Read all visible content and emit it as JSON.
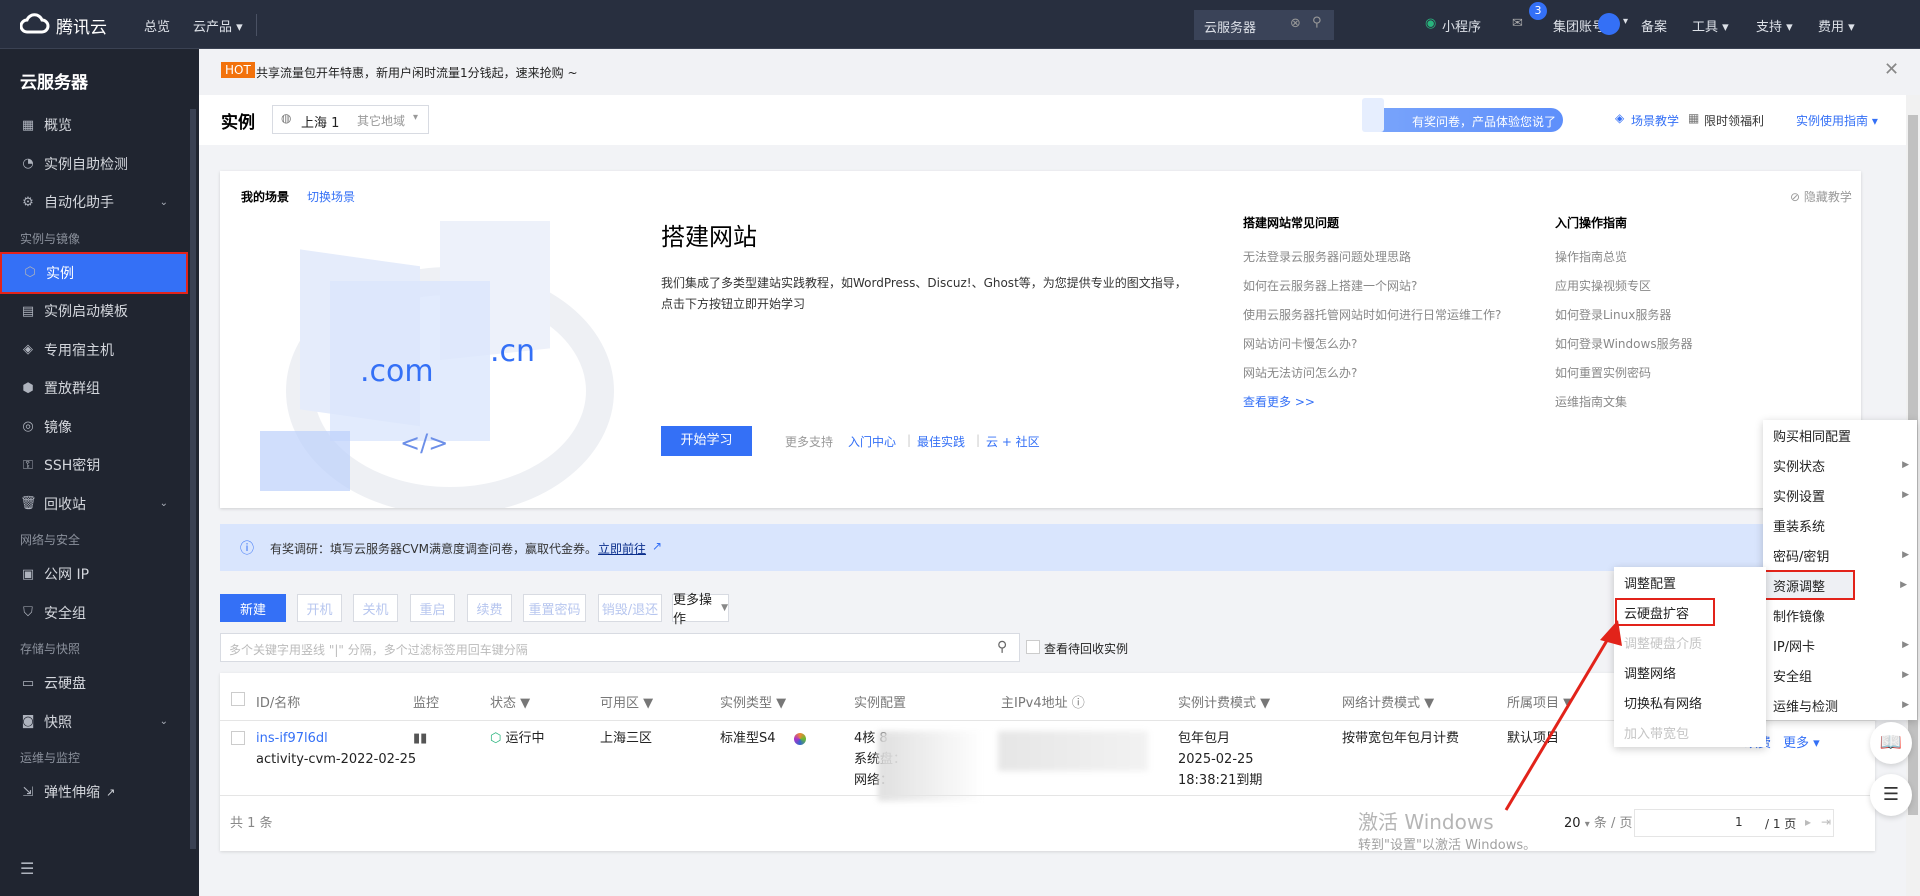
{
  "topbar": {
    "logo": "腾讯云",
    "nav": [
      "总览",
      "云产品"
    ],
    "search_value": "云服务器",
    "mini_program": "小程序",
    "mail_badge": "3",
    "items": [
      "集团账号",
      "备案",
      "工具",
      "支持",
      "费用"
    ]
  },
  "sidebar": {
    "title": "云服务器",
    "items": [
      {
        "label": "概览",
        "icon": "grid-icon"
      },
      {
        "label": "实例自助检测",
        "icon": "gauge-icon"
      },
      {
        "label": "自动化助手",
        "icon": "gear-icon",
        "arrow": true
      },
      {
        "section": "实例与镜像"
      },
      {
        "label": "实例",
        "icon": "cube-icon",
        "active": true
      },
      {
        "label": "实例启动模板",
        "icon": "template-icon"
      },
      {
        "label": "专用宿主机",
        "icon": "layers-icon"
      },
      {
        "label": "置放群组",
        "icon": "shield-icon"
      },
      {
        "label": "镜像",
        "icon": "disc-icon"
      },
      {
        "label": "SSH密钥",
        "icon": "key-icon"
      },
      {
        "label": "回收站",
        "icon": "trash-icon",
        "arrow": true
      },
      {
        "section": "网络与安全"
      },
      {
        "label": "公网 IP",
        "icon": "ip-icon"
      },
      {
        "label": "安全组",
        "icon": "security-icon"
      },
      {
        "section": "存储与快照"
      },
      {
        "label": "云硬盘",
        "icon": "disk-icon"
      },
      {
        "label": "快照",
        "icon": "camera-icon",
        "arrow": true
      },
      {
        "section": "运维与监控"
      },
      {
        "label": "弹性伸缩",
        "icon": "scale-icon",
        "external": true
      }
    ]
  },
  "hot": {
    "badge": "HOT",
    "text": "共享流量包开年特惠，新用户闲时流量1分钱起，速来抢购 ~"
  },
  "header": {
    "title": "实例",
    "region": "上海 1",
    "other_region": "其它地域",
    "survey": "有奖问卷，产品体验您说了算",
    "scene_teach": "场景教学",
    "benefit": "限时领福利",
    "guide": "实例使用指南"
  },
  "scene": {
    "label": "我的场景",
    "switch": "切换场景",
    "hide": "隐藏教学",
    "title": "搭建网站",
    "desc1": "我们集成了多类型建站实践教程，如WordPress、Discuz!、Ghost等，为您提供专业的图文指导，",
    "desc2": "点击下方按钮立即开始学习",
    "start": "开始学习",
    "more_support": "更多支持",
    "links": [
      "入门中心",
      "最佳实践",
      "云 + 社区"
    ],
    "faq_title": "搭建网站常见问题",
    "faq": [
      "无法登录云服务器问题处理思路",
      "如何在云服务器上搭建一个网站?",
      "使用云服务器托管网站时如何进行日常运维工作?",
      "网站访问卡慢怎么办?",
      "网站无法访问怎么办?"
    ],
    "faq_more": "查看更多 >>",
    "guide_title": "入门操作指南",
    "guide": [
      "操作指南总览",
      "应用实操视频专区",
      "如何登录Linux服务器",
      "如何登录Windows服务器",
      "如何重置实例密码",
      "运维指南文集"
    ]
  },
  "notice": {
    "text": "有奖调研：填写云服务器CVM满意度调查问卷，赢取代金券。",
    "link": "立即前往"
  },
  "toolbar": {
    "buttons": [
      "新建",
      "开机",
      "关机",
      "重启",
      "续费",
      "重置密码",
      "销毁/退还",
      "更多操作"
    ],
    "search_placeholder": "多个关键字用竖线 \"|\" 分隔，多个过滤标签用回车键分隔",
    "recycle": "查看待回收实例"
  },
  "table": {
    "headers": [
      "ID/名称",
      "监控",
      "状态",
      "可用区",
      "实例类型",
      "实例配置",
      "主IPv4地址",
      "实例计费模式",
      "网络计费模式",
      "所属项目"
    ],
    "row": {
      "id": "ins-if97l6dl",
      "name": "activity-cvm-2022-02-25",
      "status": "运行中",
      "zone": "上海三区",
      "type": "标准型S4",
      "config": [
        "4核 8",
        "系统盘：",
        "网络："
      ],
      "billing": [
        "包年包月",
        "2025-02-25",
        "18:38:21到期"
      ],
      "net_billing": "按带宽包年包月计费",
      "project": "默认项目",
      "actions": [
        "续费",
        "更多"
      ]
    },
    "total": "共 1 条",
    "page_size": "20",
    "per_page": "条 / 页",
    "page": "1",
    "pages": "/ 1 页"
  },
  "menu": {
    "items": [
      {
        "label": "购买相同配置"
      },
      {
        "label": "实例状态",
        "sub": true
      },
      {
        "label": "实例设置",
        "sub": true
      },
      {
        "label": "重装系统"
      },
      {
        "label": "密码/密钥",
        "sub": true
      },
      {
        "label": "资源调整",
        "sub": true,
        "highlight": true
      },
      {
        "label": "制作镜像"
      },
      {
        "label": "IP/网卡",
        "sub": true
      },
      {
        "label": "安全组",
        "sub": true
      },
      {
        "label": "运维与检测",
        "sub": true
      }
    ],
    "submenu": [
      {
        "label": "调整配置"
      },
      {
        "label": "云硬盘扩容",
        "highlight": true
      },
      {
        "label": "调整硬盘介质",
        "disabled": true
      },
      {
        "label": "调整网络"
      },
      {
        "label": "切换私有网络"
      },
      {
        "label": "加入带宽包",
        "disabled": true
      }
    ]
  },
  "watermark": {
    "line1": "激活 Windows",
    "line2": "转到\"设置\"以激活 Windows。"
  },
  "colors": {
    "accent": "#3470f6",
    "highlight": "#e2231a",
    "topbar": "#282f3f",
    "sidebar": "#202530",
    "running": "#29b47d"
  }
}
